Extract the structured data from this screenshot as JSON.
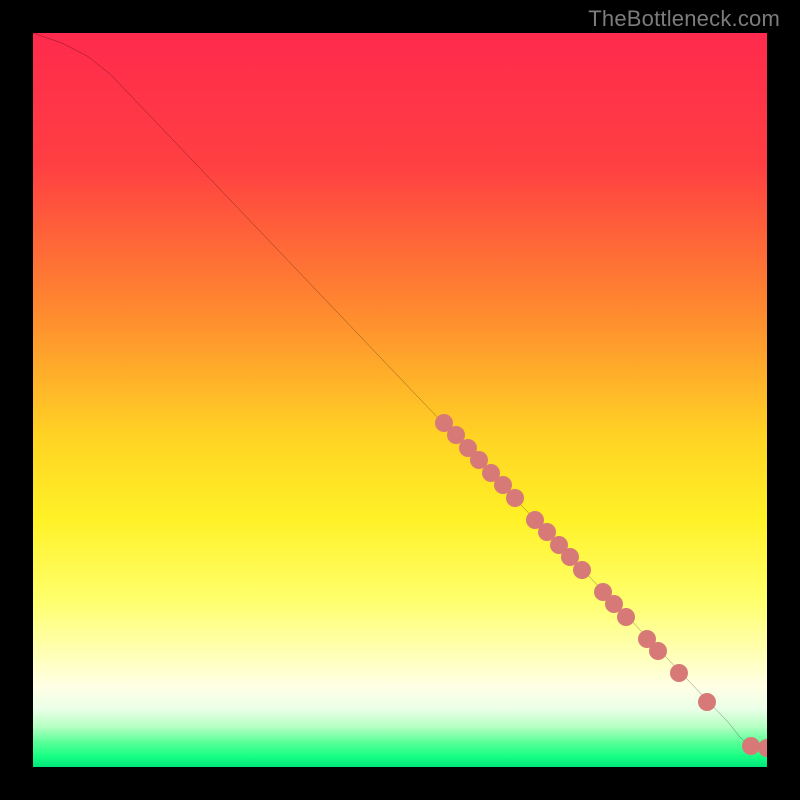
{
  "attribution": "TheBottleneck.com",
  "chart_data": {
    "type": "line",
    "title": "",
    "xlabel": "",
    "ylabel": "",
    "xlim": [
      0,
      100
    ],
    "ylim": [
      0,
      100
    ],
    "gradient_stops": [
      {
        "offset": 0,
        "color": "#ff2a4d"
      },
      {
        "offset": 18,
        "color": "#ff3f42"
      },
      {
        "offset": 38,
        "color": "#ff8a2f"
      },
      {
        "offset": 55,
        "color": "#ffd324"
      },
      {
        "offset": 66,
        "color": "#fff126"
      },
      {
        "offset": 77,
        "color": "#ffff6a"
      },
      {
        "offset": 84,
        "color": "#ffffb0"
      },
      {
        "offset": 89,
        "color": "#ffffe5"
      },
      {
        "offset": 92,
        "color": "#ecffe8"
      },
      {
        "offset": 94.5,
        "color": "#b6ffc3"
      },
      {
        "offset": 96.5,
        "color": "#5fff9a"
      },
      {
        "offset": 98.5,
        "color": "#18ff84"
      },
      {
        "offset": 100,
        "color": "#00e67a"
      }
    ],
    "series": [
      {
        "name": "curve",
        "points": [
          {
            "x": 0,
            "y": 100
          },
          {
            "x": 4,
            "y": 98.6
          },
          {
            "x": 7.5,
            "y": 96.8
          },
          {
            "x": 10.5,
            "y": 94.4
          },
          {
            "x": 13,
            "y": 91.8
          },
          {
            "x": 94.8,
            "y": 6.0
          },
          {
            "x": 96.2,
            "y": 4.2
          },
          {
            "x": 97.2,
            "y": 3.2
          },
          {
            "x": 98.0,
            "y": 2.7
          },
          {
            "x": 100,
            "y": 2.6
          }
        ]
      }
    ],
    "markers": [
      {
        "x": 56.0,
        "y": 46.9
      },
      {
        "x": 57.6,
        "y": 45.2
      },
      {
        "x": 59.2,
        "y": 43.5
      },
      {
        "x": 60.8,
        "y": 41.8
      },
      {
        "x": 62.4,
        "y": 40.1
      },
      {
        "x": 64.0,
        "y": 38.4
      },
      {
        "x": 65.6,
        "y": 36.7
      },
      {
        "x": 68.4,
        "y": 33.7
      },
      {
        "x": 70.0,
        "y": 32.0
      },
      {
        "x": 71.6,
        "y": 30.3
      },
      {
        "x": 73.2,
        "y": 28.6
      },
      {
        "x": 74.8,
        "y": 26.9
      },
      {
        "x": 77.6,
        "y": 23.9
      },
      {
        "x": 79.2,
        "y": 22.2
      },
      {
        "x": 80.8,
        "y": 20.5
      },
      {
        "x": 83.6,
        "y": 17.5
      },
      {
        "x": 85.2,
        "y": 15.8
      },
      {
        "x": 88.0,
        "y": 12.8
      },
      {
        "x": 91.8,
        "y": 8.8
      },
      {
        "x": 97.8,
        "y": 2.8
      },
      {
        "x": 100.0,
        "y": 2.6
      }
    ]
  }
}
